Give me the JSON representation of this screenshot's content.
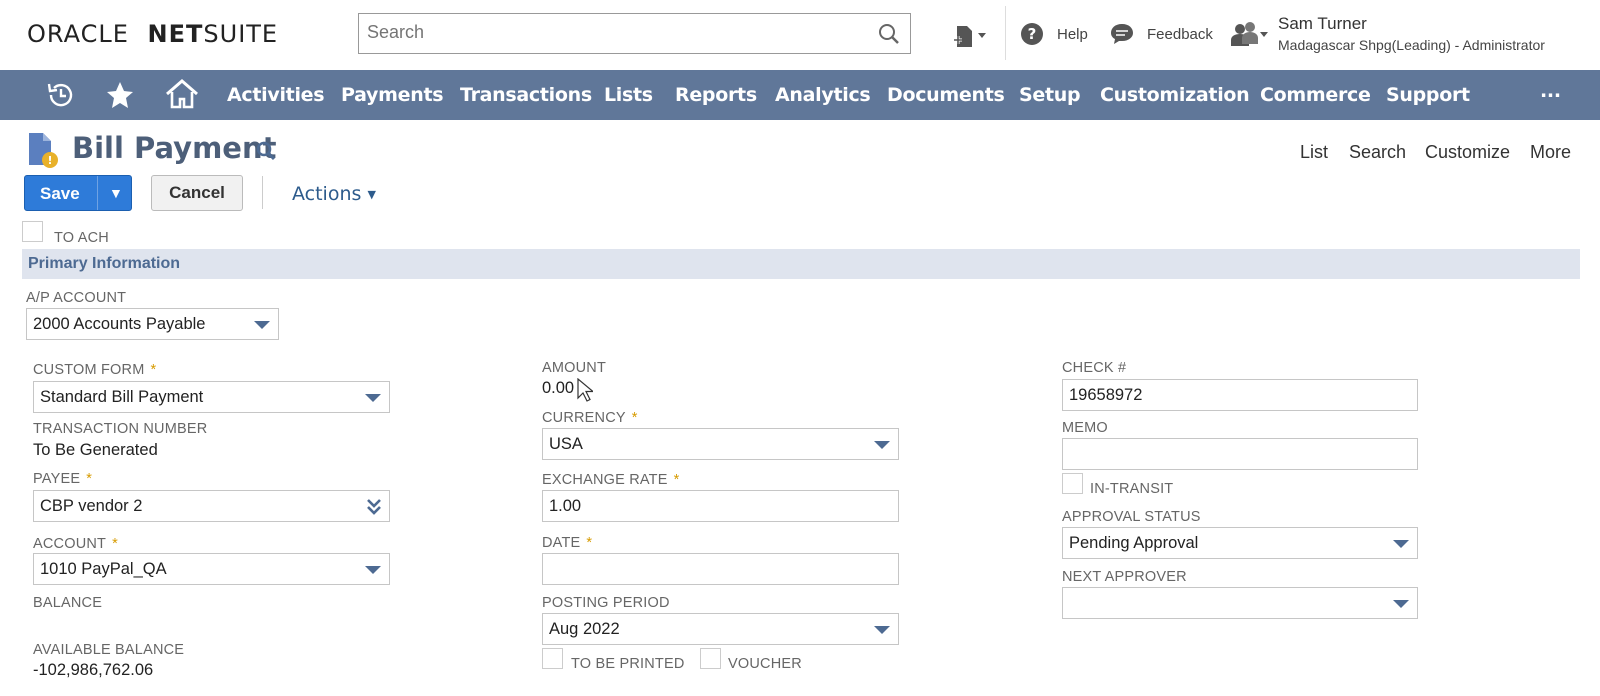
{
  "header": {
    "logo_part1": "ORACLE",
    "logo_part2": "NET",
    "logo_part3": "SUITE",
    "search_placeholder": "Search",
    "help_label": "Help",
    "feedback_label": "Feedback",
    "user_name": "Sam Turner",
    "user_role": "Madagascar Shpg(Leading) - Administrator"
  },
  "nav": {
    "items": [
      "Activities",
      "Payments",
      "Transactions",
      "Lists",
      "Reports",
      "Analytics",
      "Documents",
      "Setup",
      "Customization",
      "Commerce",
      "Support"
    ],
    "more": "..."
  },
  "page": {
    "title": "Bill Payment",
    "links": [
      "List",
      "Search",
      "Customize",
      "More"
    ],
    "save_label": "Save",
    "cancel_label": "Cancel",
    "actions_label": "Actions"
  },
  "form": {
    "to_ach_label": "TO ACH",
    "section_title": "Primary Information",
    "ap_account_label": "A/P ACCOUNT",
    "ap_account_value": "2000 Accounts Payable",
    "custom_form_label": "CUSTOM FORM",
    "custom_form_value": "Standard Bill Payment",
    "transaction_number_label": "TRANSACTION NUMBER",
    "transaction_number_value": "To Be Generated",
    "payee_label": "PAYEE",
    "payee_value": "CBP vendor 2",
    "account_label": "ACCOUNT",
    "account_value": "1010 PayPal_QA",
    "balance_label": "BALANCE",
    "available_balance_label": "AVAILABLE BALANCE",
    "available_balance_value": "-102,986,762.06",
    "amount_label": "AMOUNT",
    "amount_value": "0.00",
    "currency_label": "CURRENCY",
    "currency_value": "USA",
    "exchange_rate_label": "EXCHANGE RATE",
    "exchange_rate_value": "1.00",
    "date_label": "DATE",
    "date_value": "",
    "posting_period_label": "POSTING PERIOD",
    "posting_period_value": "Aug 2022",
    "to_be_printed_label": "TO BE PRINTED",
    "voucher_label": "VOUCHER",
    "check_label": "CHECK #",
    "check_value": "19658972",
    "memo_label": "MEMO",
    "memo_value": "",
    "in_transit_label": "IN-TRANSIT",
    "approval_status_label": "APPROVAL STATUS",
    "approval_status_value": "Pending Approval",
    "next_approver_label": "NEXT APPROVER",
    "next_approver_value": "",
    "required_mark": "*"
  },
  "colors": {
    "nav_bg": "#607799",
    "save_button": "#2e7bd9",
    "section_bg": "#dfe4ee",
    "title_color": "#4d5f79",
    "required": "#d79b00"
  }
}
